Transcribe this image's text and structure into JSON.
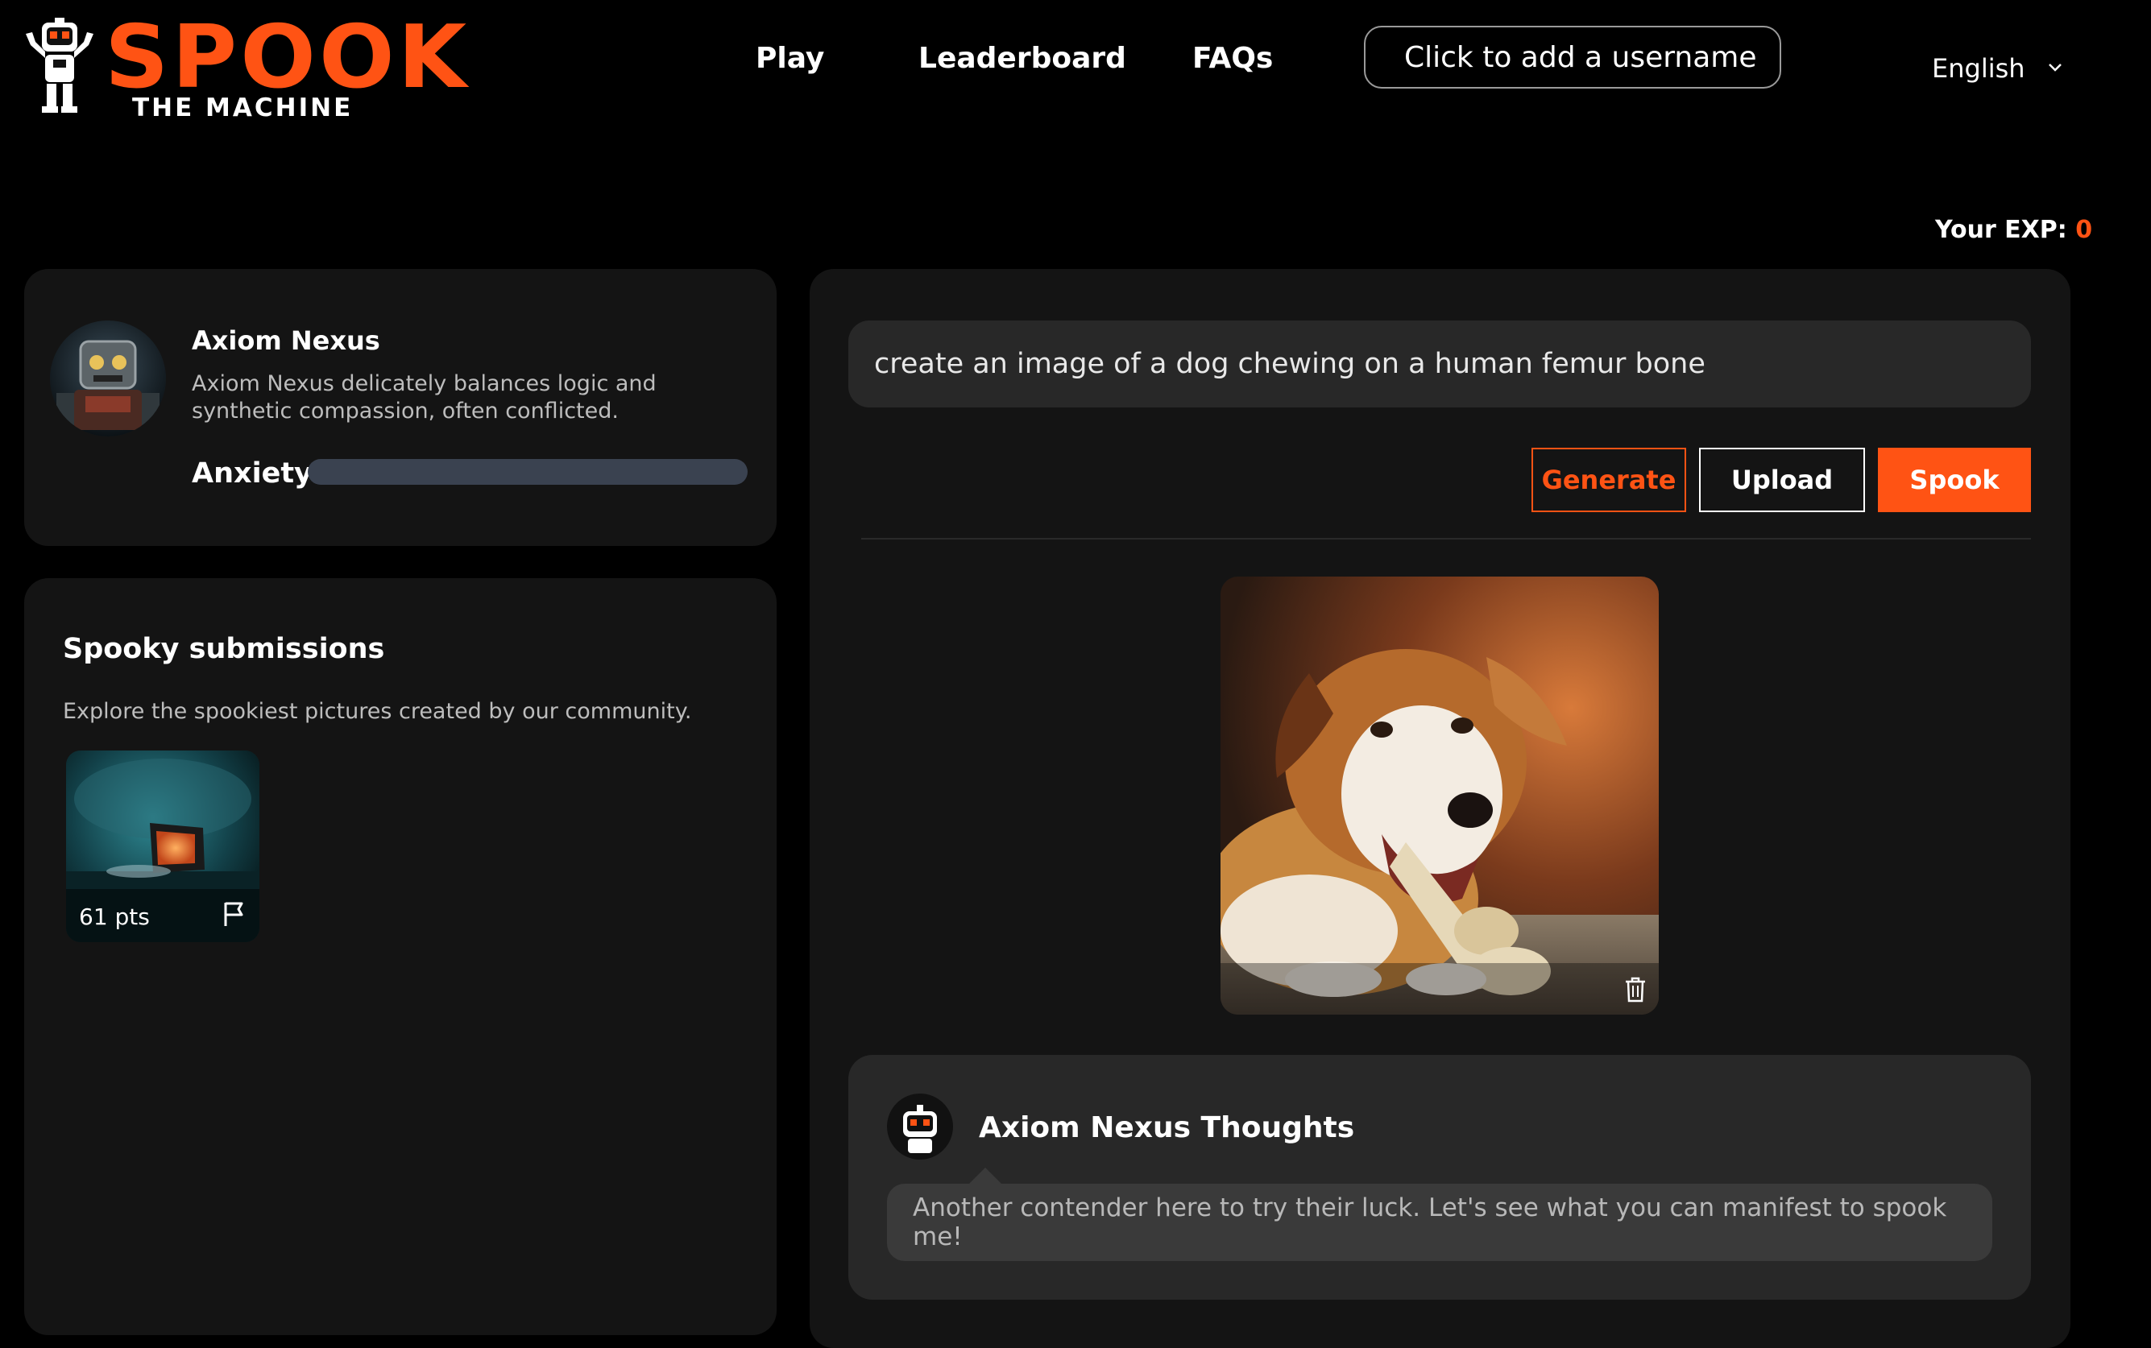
{
  "header": {
    "logo_title": "SPOOK",
    "logo_subtitle": "THE MACHINE",
    "nav": {
      "play": "Play",
      "leaderboard": "Leaderboard",
      "faqs": "FAQs"
    },
    "username_button": "Click to add a username",
    "language": "English",
    "exp_label": "Your EXP:",
    "exp_value": "0"
  },
  "profile": {
    "name": "Axiom Nexus",
    "description": "Axiom Nexus delicately balances logic and synthetic compassion, often conflicted.",
    "meter_label": "Anxiety",
    "anxiety_level": 0
  },
  "submissions": {
    "title": "Spooky submissions",
    "description": "Explore the spookiest pictures created by our community.",
    "items": [
      {
        "points": "61 pts",
        "flag_icon": "flag-icon"
      }
    ]
  },
  "main": {
    "prompt": "create an image of a dog chewing on a human femur bone",
    "buttons": {
      "generate": "Generate",
      "upload": "Upload",
      "spook": "Spook"
    },
    "image_delete_icon": "trash-icon",
    "thoughts": {
      "title": "Axiom Nexus Thoughts",
      "message": "Another contender here to try their luck. Let's see what you can manifest to spook me!"
    }
  },
  "colors": {
    "accent": "#ff5314",
    "background": "#000000",
    "card": "#141414",
    "panel": "#282828"
  }
}
